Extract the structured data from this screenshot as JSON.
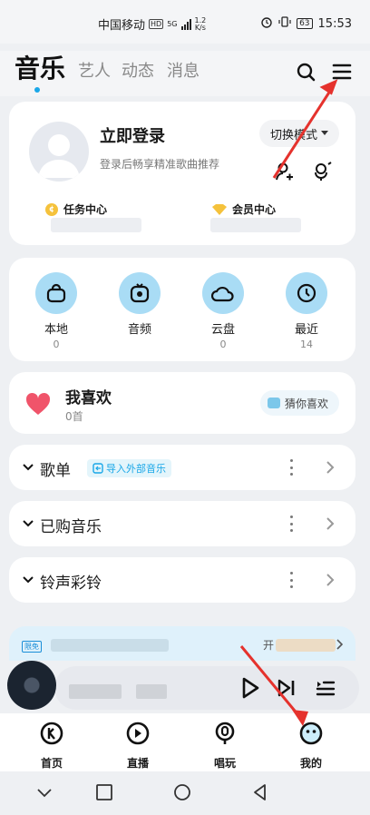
{
  "status_bar": {
    "carrier": "中国移动",
    "hd": "HD",
    "network": "5G",
    "speed_value": "1.2",
    "speed_unit": "K/s",
    "battery": "63",
    "time": "15:53"
  },
  "top_tabs": [
    {
      "label": "音乐",
      "active": true
    },
    {
      "label": "艺人",
      "active": false
    },
    {
      "label": "动态",
      "active": false
    },
    {
      "label": "消息",
      "active": false
    }
  ],
  "profile": {
    "login_title": "立即登录",
    "login_subtitle": "登录后畅享精准歌曲推荐",
    "switch_mode": "切换模式",
    "task_center": "任务中心",
    "member_center": "会员中心"
  },
  "quick_access": [
    {
      "label": "本地",
      "count": "0",
      "icon": "bag-icon"
    },
    {
      "label": "音频",
      "count": "",
      "icon": "radio-icon"
    },
    {
      "label": "云盘",
      "count": "0",
      "icon": "cloud-icon"
    },
    {
      "label": "最近",
      "count": "14",
      "icon": "clock-icon"
    }
  ],
  "favorites": {
    "title": "我喜欢",
    "count": "0首",
    "guess_button": "猜你喜欢"
  },
  "sections": [
    {
      "title": "歌单",
      "badge": "导入外部音乐"
    },
    {
      "title": "已购音乐",
      "badge": ""
    },
    {
      "title": "铃声彩铃",
      "badge": ""
    }
  ],
  "vip_banner": {
    "tag": "限免",
    "text": "开"
  },
  "bottom_tabs": [
    {
      "label": "首页",
      "icon": "k-logo-icon"
    },
    {
      "label": "直播",
      "icon": "play-circle-icon"
    },
    {
      "label": "唱玩",
      "icon": "mic-icon"
    },
    {
      "label": "我的",
      "icon": "face-icon"
    }
  ],
  "colors": {
    "accent": "#1aa7e8",
    "quick_circle": "#a9dcf5",
    "heart": "#f0546a",
    "annotation_arrow": "#e5322d"
  }
}
